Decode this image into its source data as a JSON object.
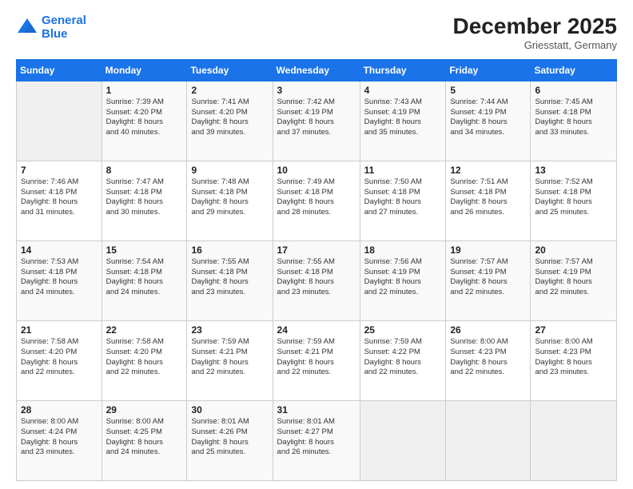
{
  "logo": {
    "line1": "General",
    "line2": "Blue"
  },
  "title": "December 2025",
  "location": "Griesstatt, Germany",
  "days_header": [
    "Sunday",
    "Monday",
    "Tuesday",
    "Wednesday",
    "Thursday",
    "Friday",
    "Saturday"
  ],
  "weeks": [
    [
      {
        "day": "",
        "info": ""
      },
      {
        "day": "1",
        "info": "Sunrise: 7:39 AM\nSunset: 4:20 PM\nDaylight: 8 hours\nand 40 minutes."
      },
      {
        "day": "2",
        "info": "Sunrise: 7:41 AM\nSunset: 4:20 PM\nDaylight: 8 hours\nand 39 minutes."
      },
      {
        "day": "3",
        "info": "Sunrise: 7:42 AM\nSunset: 4:19 PM\nDaylight: 8 hours\nand 37 minutes."
      },
      {
        "day": "4",
        "info": "Sunrise: 7:43 AM\nSunset: 4:19 PM\nDaylight: 8 hours\nand 35 minutes."
      },
      {
        "day": "5",
        "info": "Sunrise: 7:44 AM\nSunset: 4:19 PM\nDaylight: 8 hours\nand 34 minutes."
      },
      {
        "day": "6",
        "info": "Sunrise: 7:45 AM\nSunset: 4:18 PM\nDaylight: 8 hours\nand 33 minutes."
      }
    ],
    [
      {
        "day": "7",
        "info": "Sunrise: 7:46 AM\nSunset: 4:18 PM\nDaylight: 8 hours\nand 31 minutes."
      },
      {
        "day": "8",
        "info": "Sunrise: 7:47 AM\nSunset: 4:18 PM\nDaylight: 8 hours\nand 30 minutes."
      },
      {
        "day": "9",
        "info": "Sunrise: 7:48 AM\nSunset: 4:18 PM\nDaylight: 8 hours\nand 29 minutes."
      },
      {
        "day": "10",
        "info": "Sunrise: 7:49 AM\nSunset: 4:18 PM\nDaylight: 8 hours\nand 28 minutes."
      },
      {
        "day": "11",
        "info": "Sunrise: 7:50 AM\nSunset: 4:18 PM\nDaylight: 8 hours\nand 27 minutes."
      },
      {
        "day": "12",
        "info": "Sunrise: 7:51 AM\nSunset: 4:18 PM\nDaylight: 8 hours\nand 26 minutes."
      },
      {
        "day": "13",
        "info": "Sunrise: 7:52 AM\nSunset: 4:18 PM\nDaylight: 8 hours\nand 25 minutes."
      }
    ],
    [
      {
        "day": "14",
        "info": "Sunrise: 7:53 AM\nSunset: 4:18 PM\nDaylight: 8 hours\nand 24 minutes."
      },
      {
        "day": "15",
        "info": "Sunrise: 7:54 AM\nSunset: 4:18 PM\nDaylight: 8 hours\nand 24 minutes."
      },
      {
        "day": "16",
        "info": "Sunrise: 7:55 AM\nSunset: 4:18 PM\nDaylight: 8 hours\nand 23 minutes."
      },
      {
        "day": "17",
        "info": "Sunrise: 7:55 AM\nSunset: 4:18 PM\nDaylight: 8 hours\nand 23 minutes."
      },
      {
        "day": "18",
        "info": "Sunrise: 7:56 AM\nSunset: 4:19 PM\nDaylight: 8 hours\nand 22 minutes."
      },
      {
        "day": "19",
        "info": "Sunrise: 7:57 AM\nSunset: 4:19 PM\nDaylight: 8 hours\nand 22 minutes."
      },
      {
        "day": "20",
        "info": "Sunrise: 7:57 AM\nSunset: 4:19 PM\nDaylight: 8 hours\nand 22 minutes."
      }
    ],
    [
      {
        "day": "21",
        "info": "Sunrise: 7:58 AM\nSunset: 4:20 PM\nDaylight: 8 hours\nand 22 minutes."
      },
      {
        "day": "22",
        "info": "Sunrise: 7:58 AM\nSunset: 4:20 PM\nDaylight: 8 hours\nand 22 minutes."
      },
      {
        "day": "23",
        "info": "Sunrise: 7:59 AM\nSunset: 4:21 PM\nDaylight: 8 hours\nand 22 minutes."
      },
      {
        "day": "24",
        "info": "Sunrise: 7:59 AM\nSunset: 4:21 PM\nDaylight: 8 hours\nand 22 minutes."
      },
      {
        "day": "25",
        "info": "Sunrise: 7:59 AM\nSunset: 4:22 PM\nDaylight: 8 hours\nand 22 minutes."
      },
      {
        "day": "26",
        "info": "Sunrise: 8:00 AM\nSunset: 4:23 PM\nDaylight: 8 hours\nand 22 minutes."
      },
      {
        "day": "27",
        "info": "Sunrise: 8:00 AM\nSunset: 4:23 PM\nDaylight: 8 hours\nand 23 minutes."
      }
    ],
    [
      {
        "day": "28",
        "info": "Sunrise: 8:00 AM\nSunset: 4:24 PM\nDaylight: 8 hours\nand 23 minutes."
      },
      {
        "day": "29",
        "info": "Sunrise: 8:00 AM\nSunset: 4:25 PM\nDaylight: 8 hours\nand 24 minutes."
      },
      {
        "day": "30",
        "info": "Sunrise: 8:01 AM\nSunset: 4:26 PM\nDaylight: 8 hours\nand 25 minutes."
      },
      {
        "day": "31",
        "info": "Sunrise: 8:01 AM\nSunset: 4:27 PM\nDaylight: 8 hours\nand 26 minutes."
      },
      {
        "day": "",
        "info": ""
      },
      {
        "day": "",
        "info": ""
      },
      {
        "day": "",
        "info": ""
      }
    ]
  ]
}
